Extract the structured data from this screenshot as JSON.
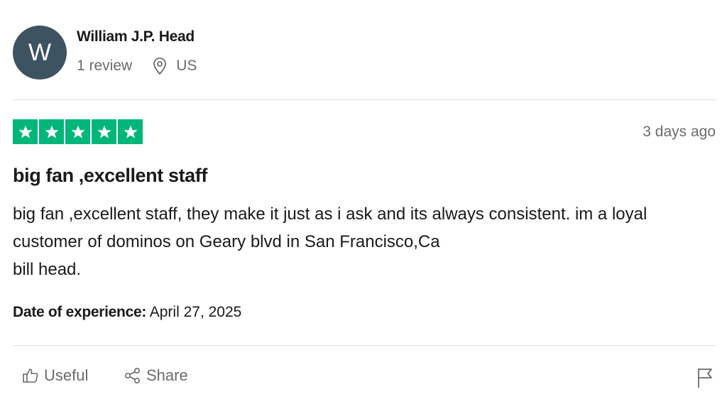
{
  "reviewer": {
    "initial": "W",
    "name": "William J.P. Head",
    "review_count": "1 review",
    "location": "US"
  },
  "review": {
    "rating": 5,
    "date": "3 days ago",
    "title": "big fan ,excellent staff",
    "body": "big fan ,excellent staff, they make it just as i ask and its always consistent. im a loyal customer of dominos on Geary blvd in San Francisco,Ca\nbill head.",
    "experience_label": "Date of experience:",
    "experience_date": "April 27, 2025"
  },
  "actions": {
    "useful_label": "Useful",
    "share_label": "Share"
  },
  "colors": {
    "star_green": "#00b67a",
    "avatar_bg": "#3d5361",
    "muted_text": "#6b6b6b"
  },
  "icons": {
    "location": "location-pin-icon",
    "useful": "thumbs-up-icon",
    "share": "share-icon",
    "flag": "flag-icon",
    "star": "star-icon"
  }
}
